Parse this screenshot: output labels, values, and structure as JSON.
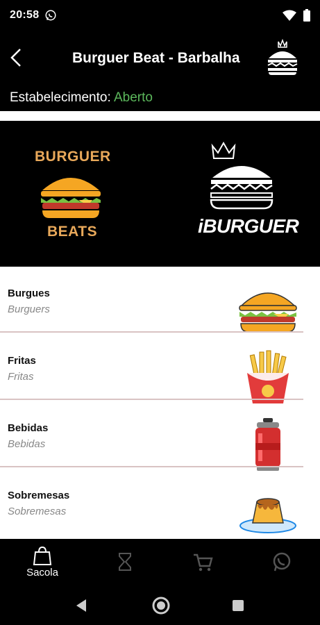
{
  "status_bar": {
    "time": "20:58"
  },
  "header": {
    "title": "Burguer Beat - Barbalha"
  },
  "establishment": {
    "label": "Estabelecimento:",
    "status": "Aberto",
    "status_color": "#5cb85c"
  },
  "banner": {
    "left_logo": {
      "top_text": "BURGUER",
      "bottom_text": "BEATS"
    },
    "right_logo": {
      "text": "iBURGUER"
    }
  },
  "menu": {
    "items": [
      {
        "title": "Burgues",
        "subtitle": "Burguers",
        "icon": "burger-icon"
      },
      {
        "title": "Fritas",
        "subtitle": "Fritas",
        "icon": "fries-icon"
      },
      {
        "title": "Bebidas",
        "subtitle": "Bebidas",
        "icon": "soda-can-icon"
      },
      {
        "title": "Sobremesas",
        "subtitle": "Sobremesas",
        "icon": "pudding-icon"
      }
    ]
  },
  "bottom_nav": {
    "items": [
      {
        "label": "Sacola",
        "icon": "bag-icon",
        "active": true
      },
      {
        "label": "",
        "icon": "hourglass-icon",
        "active": false
      },
      {
        "label": "",
        "icon": "cart-icon",
        "active": false
      },
      {
        "label": "",
        "icon": "whatsapp-icon",
        "active": false
      }
    ]
  }
}
